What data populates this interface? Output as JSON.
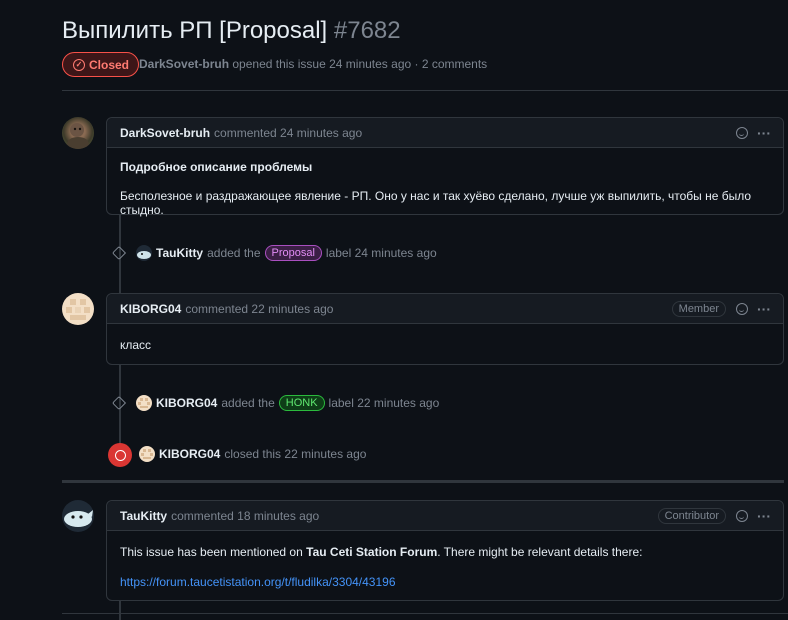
{
  "issue": {
    "title": "Выпилить РП [Proposal]",
    "number": "#7682",
    "status": "Closed",
    "author": "DarkSovet-bruh",
    "meta_text": "opened this issue 24 minutes ago · 2 comments"
  },
  "comments": [
    {
      "author": "DarkSovet-bruh",
      "action": "commented 24 minutes ago",
      "heading": "Подробное описание проблемы",
      "body": "Бесполезное и раздражающее явление - РП. Оно у нас и так хуёво сделано, лучше уж выпилить, чтобы не было стыдно."
    },
    {
      "author": "KIBORG04",
      "action": "commented 22 minutes ago",
      "role": "Member",
      "body": "класс"
    },
    {
      "author": "TauKitty",
      "action": "commented 18 minutes ago",
      "role": "Contributor",
      "body_prefix": "This issue has been mentioned on ",
      "body_bold": "Tau Ceti Station Forum",
      "body_suffix": ". There might be relevant details there:",
      "link": "https://forum.taucetistation.org/t/fludilka/3304/43196"
    }
  ],
  "events": [
    {
      "actor": "TauKitty",
      "pre": "added the",
      "label": "Proposal",
      "post": "label 24 minutes ago"
    },
    {
      "actor": "KIBORG04",
      "pre": "added the",
      "label": "HONK",
      "post": "label 22 minutes ago"
    },
    {
      "actor": "KIBORG04",
      "text": "closed this 22 minutes ago"
    }
  ],
  "colors": {
    "closed": "#da3633",
    "link": "#4493f8",
    "proposal": "#a94fc0",
    "honk": "#2bbb3d"
  }
}
